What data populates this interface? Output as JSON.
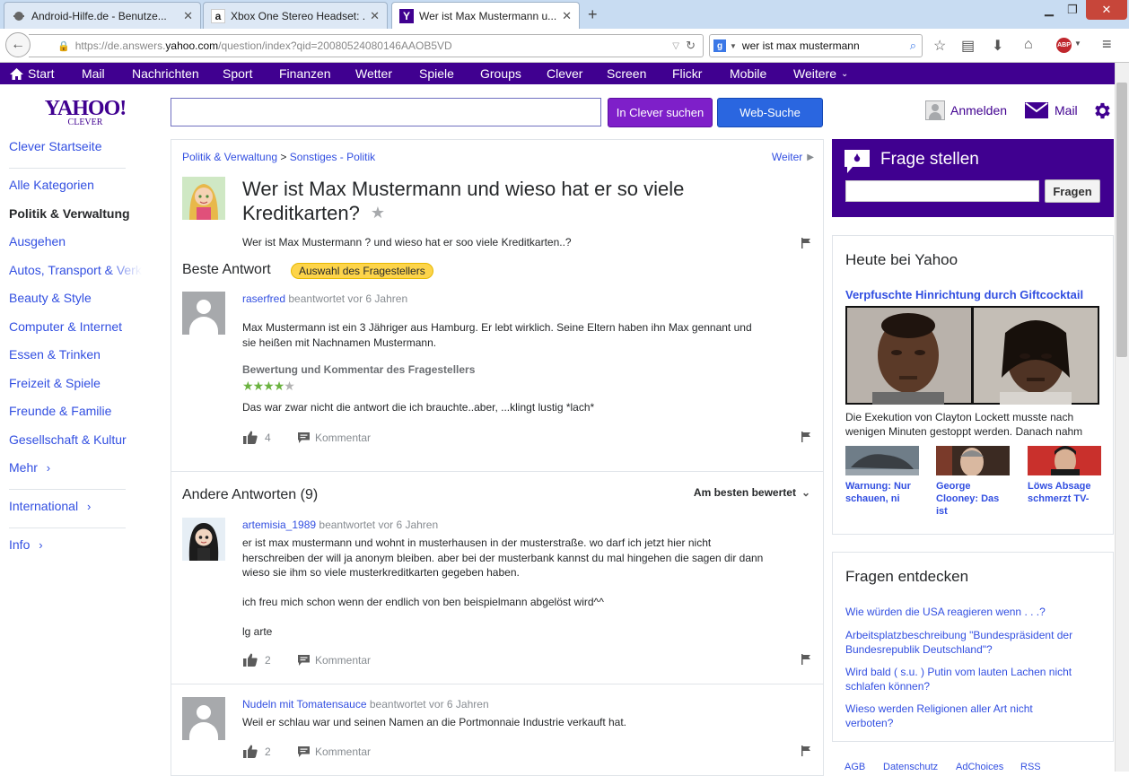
{
  "browser": {
    "tabs": [
      {
        "title": "Android-Hilfe.de - Benutze...",
        "icon": "android-icon"
      },
      {
        "title": "Xbox One Stereo Headset: ...",
        "icon": "amazon-icon"
      },
      {
        "title": "Wer ist Max Mustermann u...",
        "icon": "yahoo-icon"
      }
    ],
    "url_prefix": "https://de.answers.",
    "url_domain": "yahoo.com",
    "url_path": "/question/index?qid=20080524080146AAOB5VD",
    "search_query": "wer ist max mustermann"
  },
  "ynav": [
    "Start",
    "Mail",
    "Nachrichten",
    "Sport",
    "Finanzen",
    "Wetter",
    "Spiele",
    "Groups",
    "Clever",
    "Screen",
    "Flickr",
    "Mobile",
    "Weitere"
  ],
  "header": {
    "logo_main": "YAHOO!",
    "logo_sub": "CLEVER",
    "search_value": "",
    "btn_clever": "In Clever suchen",
    "btn_web": "Web-Suche",
    "signin": "Anmelden",
    "mail": "Mail"
  },
  "leftnav": [
    "Clever Startseite",
    "Alle Kategorien",
    "Politik & Verwaltung",
    "Ausgehen",
    "Autos, Transport & Verkehr",
    "Beauty & Style",
    "Computer & Internet",
    "Essen & Trinken",
    "Freizeit & Spiele",
    "Freunde & Familie",
    "Gesellschaft & Kultur",
    "Mehr",
    "International",
    "Info"
  ],
  "question": {
    "breadcrumb_cat": "Politik & Verwaltung",
    "breadcrumb_sep": ">",
    "breadcrumb_sub": "Sonstiges - Politik",
    "weiter": "Weiter",
    "title_line1": "Wer ist Max Mustermann und wieso hat er so viele",
    "title_line2": "Kreditkarten?",
    "body": "Wer ist Max Mustermann ? und wieso hat er soo viele Kreditkarten..?"
  },
  "best": {
    "heading": "Beste Antwort",
    "badge": "Auswahl des Fragestellers",
    "user": "raserfred",
    "meta": "beantwortet vor 6 Jahren",
    "text_line1": "Max Mustermann ist ein 3 Jähriger aus Hamburg. Er lebt wirklich. Seine Eltern haben ihn Max gennant und",
    "text_line2": "sie heißen mit Nachnamen Mustermann.",
    "rating_title": "Bewertung und Kommentar des Fragestellers",
    "rating_stars": 4,
    "rating_max": 5,
    "comment": "Das war zwar nicht die antwort die ich brauchte..aber, ...klingt lustig *lach*",
    "likes": "4",
    "kommentar": "Kommentar"
  },
  "others": {
    "heading": "Andere Antworten (9)",
    "sort": "Am besten bewertet",
    "answers": [
      {
        "user": "artemisia_1989",
        "meta": "beantwortet vor 6 Jahren",
        "lines": [
          "er ist max mustermann und wohnt in musterhausen in der musterstraße. wo darf ich jetzt hier nicht",
          "herschreiben der will ja anonym bleiben. aber bei der musterbank kannst du mal hingehen die sagen dir dann",
          "wieso sie ihm so viele musterkreditkarten gegeben haben.",
          "",
          "ich freu mich schon wenn der endlich von ben beispielmann abgelöst wird^^",
          "",
          "lg arte"
        ],
        "likes": "2",
        "kommentar": "Kommentar"
      },
      {
        "user": "Nudeln mit Tomatensauce",
        "meta": "beantwortet vor 6 Jahren",
        "lines": [
          "Weil er schlau war und seinen Namen an die Portmonnaie Industrie verkauft hat."
        ],
        "likes": "2",
        "kommentar": "Kommentar"
      }
    ]
  },
  "ask": {
    "title": "Frage stellen",
    "input": "",
    "button": "Fragen"
  },
  "today": {
    "heading": "Heute bei Yahoo",
    "headline": "Verpfuschte Hinrichtung durch Giftcocktail",
    "caption_line1": "Die Exekution von Clayton Lockett musste nach",
    "caption_line2": "wenigen Minuten gestoppt werden. Danach nahm",
    "thumbs": [
      {
        "line1": "Warnung: Nur",
        "line2": "schauen, ni"
      },
      {
        "line1": "George",
        "line2": "Clooney: Das",
        "line3": "ist"
      },
      {
        "line1": "Löws Absage",
        "line2": "schmerzt TV-"
      }
    ]
  },
  "discover": {
    "heading": "Fragen entdecken",
    "items": [
      {
        "line1": "Wie würden die USA reagieren wenn . . .?",
        "line2": ""
      },
      {
        "line1": "Arbeitsplatzbeschreibung \"Bundespräsident der",
        "line2": "Bundesrepublik Deutschland\"?"
      },
      {
        "line1": "Wird bald ( s.u. ) Putin vom lauten Lachen nicht",
        "line2": "schlafen können?"
      },
      {
        "line1": "Wieso werden Religionen aller Art nicht",
        "line2": "verboten?"
      }
    ]
  },
  "footer": [
    "AGB",
    "Datenschutz",
    "AdChoices",
    "RSS"
  ],
  "colors": {
    "yahoo_purple": "#400090",
    "link_blue": "#324fe1",
    "star_green": "#6ab23f",
    "badge_yellow": "#fdd44a"
  }
}
